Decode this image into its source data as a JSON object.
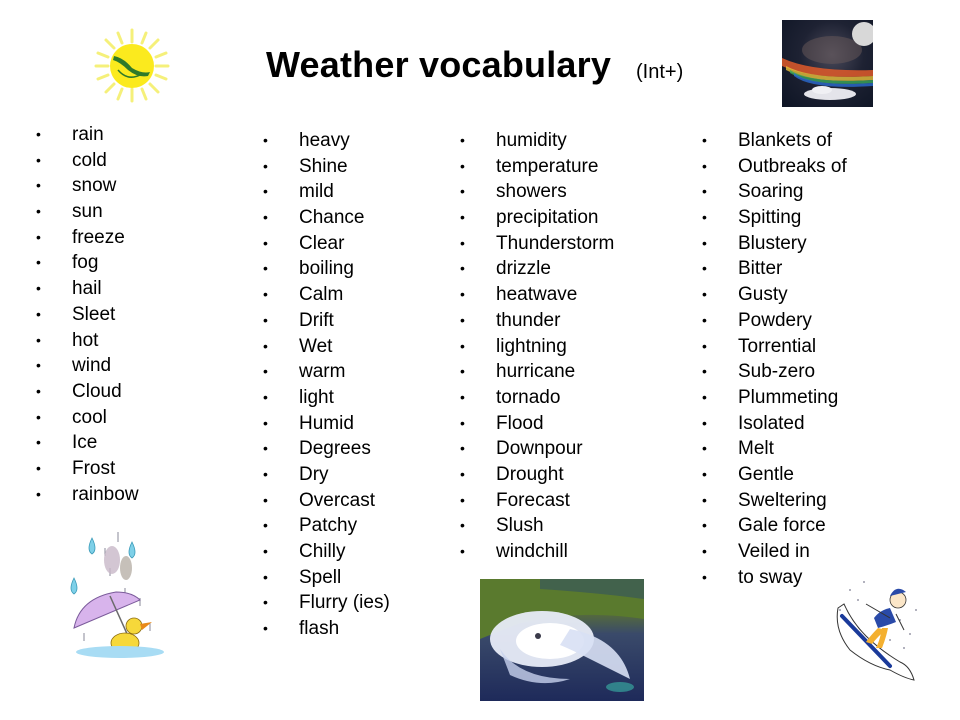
{
  "header": {
    "title": "Weather vocabulary",
    "level": "(Int+)"
  },
  "images": {
    "sun": "smiling sun with sunglasses clipart",
    "rainbow": "fire rainbow in night sky photo",
    "duck": "duck with umbrella in rain clipart",
    "hurricane": "satellite image of hurricane",
    "skier": "skier going downhill in snow clipart"
  },
  "bullet": "•",
  "columns": [
    [
      "rain",
      "cold",
      "snow",
      "sun",
      "freeze",
      "fog",
      "hail",
      "Sleet",
      "hot",
      "wind",
      "Cloud",
      "cool",
      "Ice",
      "Frost",
      "rainbow"
    ],
    [
      "heavy",
      "Shine",
      "mild",
      "Chance",
      "Clear",
      "boiling",
      "Calm",
      "Drift",
      "Wet",
      "warm",
      "light",
      "Humid",
      "Degrees",
      "Dry",
      "Overcast",
      "Patchy",
      "Chilly",
      "Spell",
      "Flurry (ies)",
      "flash"
    ],
    [
      "humidity",
      "temperature",
      "showers",
      "precipitation",
      "Thunderstorm",
      "drizzle",
      "heatwave",
      "thunder",
      "lightning",
      "hurricane",
      "tornado",
      "Flood",
      "Downpour",
      "Drought",
      "Forecast",
      "Slush",
      "windchill"
    ],
    [
      "Blankets of",
      "Outbreaks of",
      "Soaring",
      "Spitting",
      "Blustery",
      "Bitter",
      "Gusty",
      "Powdery",
      "Torrential",
      "Sub-zero",
      "Plummeting",
      "Isolated",
      "Melt",
      "Gentle",
      "Sweltering",
      "Gale force",
      "Veiled in",
      "to sway"
    ]
  ]
}
